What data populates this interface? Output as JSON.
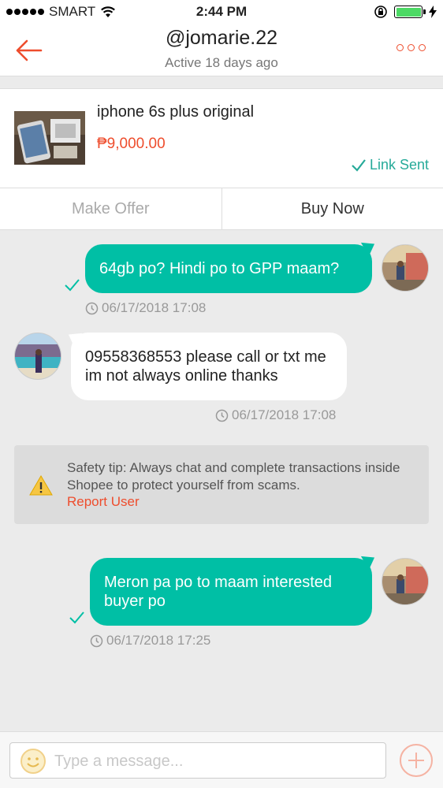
{
  "status_bar": {
    "carrier": "SMART",
    "time": "2:44 PM"
  },
  "header": {
    "title": "@jomarie.22",
    "subtitle": "Active 18 days ago"
  },
  "product": {
    "name": "iphone 6s plus original",
    "price": "₱9,000.00",
    "link_status": "Link Sent",
    "make_offer_label": "Make Offer",
    "buy_now_label": "Buy Now"
  },
  "messages": [
    {
      "direction": "out",
      "text": "64gb po? Hindi po to GPP maam?",
      "time": "06/17/2018 17:08"
    },
    {
      "direction": "in",
      "text": "09558368553 please call or txt me im not always online thanks",
      "time": "06/17/2018 17:08"
    },
    {
      "direction": "out",
      "text": "Meron pa po to maam interested buyer po",
      "time": "06/17/2018 17:25"
    }
  ],
  "safety_tip": {
    "text": "Safety tip: Always chat and complete transactions inside Shopee to protect yourself from scams.",
    "report_label": "Report User"
  },
  "composer": {
    "placeholder": "Type a message..."
  },
  "colors": {
    "brand": "#ee4d2d",
    "teal": "#00bfa5",
    "link_sent": "#26aa99"
  }
}
